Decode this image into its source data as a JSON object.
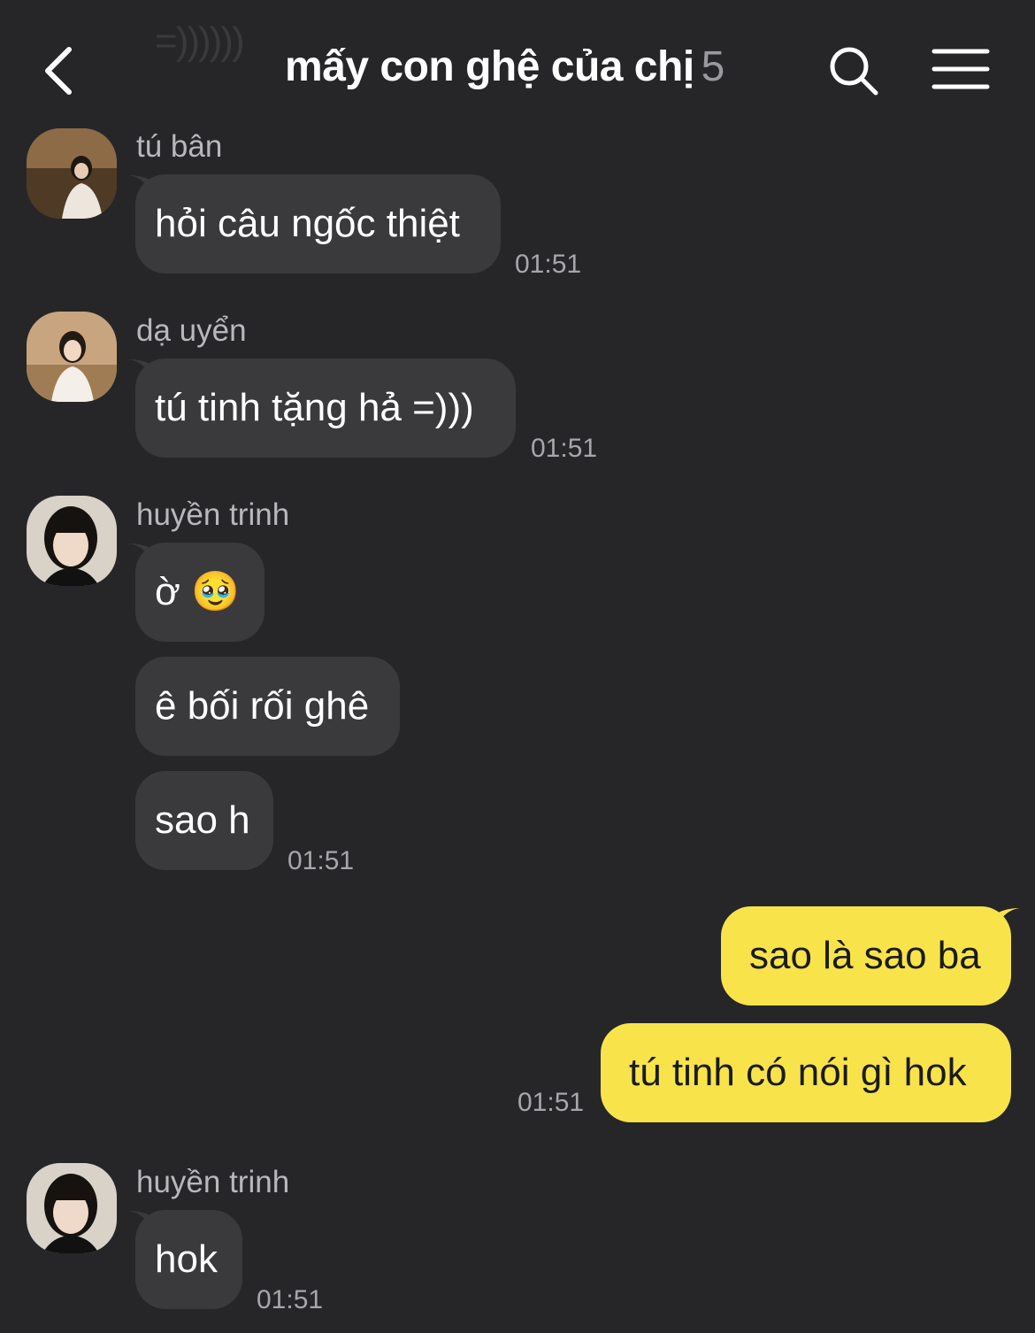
{
  "header": {
    "ghost_text": "=))))))",
    "title": "mấy con ghệ của chị",
    "member_count": "5"
  },
  "messages": [
    {
      "sender": "tú bân",
      "texts": [
        "hỏi câu ngốc thiệt"
      ],
      "time": "01:51"
    },
    {
      "sender": "dạ uyển",
      "texts": [
        "tú tinh tặng hả =)))"
      ],
      "time": "01:51"
    },
    {
      "sender": "huyền trinh",
      "texts": [
        "ờ 🥹",
        "ê bối rối ghê",
        "sao h"
      ],
      "time": "01:51"
    },
    {
      "sender": "me",
      "texts": [
        "sao là sao ba",
        "tú tinh có nói gì hok"
      ],
      "time": "01:51"
    },
    {
      "sender": "huyền trinh",
      "texts": [
        "hok"
      ],
      "time": "01:51"
    }
  ],
  "colors": {
    "background": "#262629",
    "bubble_other": "#3a3a3d",
    "bubble_mine": "#f8e44a"
  }
}
